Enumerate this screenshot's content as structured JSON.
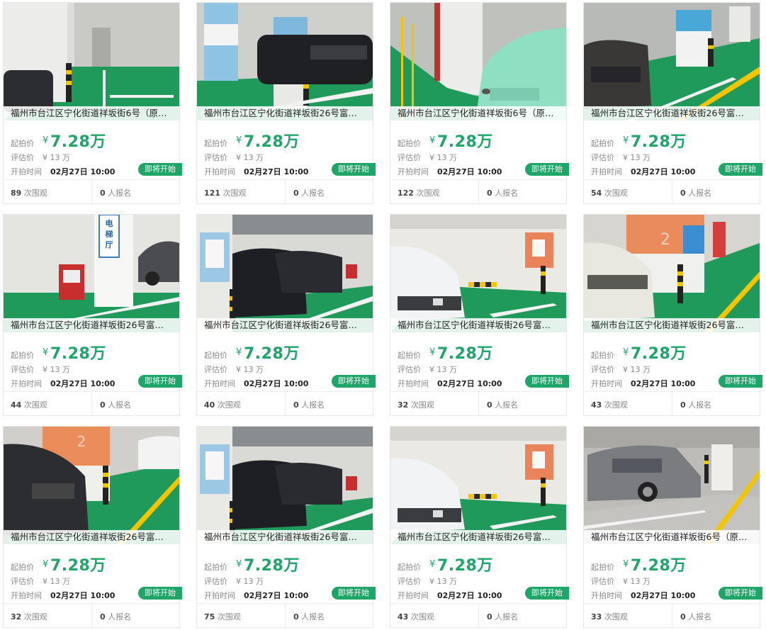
{
  "colors": {
    "accent": "#1ea668"
  },
  "labels": {
    "start_price": "起拍价",
    "estimate": "评估价",
    "start_time": "开拍时间",
    "yen": "¥",
    "views_suffix": "次围观",
    "signups_suffix": "人报名"
  },
  "listings": [
    {
      "title": "福州市台江区宁化街道祥坂街6号（原…",
      "price": "7.28万",
      "estimate": "¥ 13 万",
      "time": "02月27日 10:00",
      "status": "即将开始",
      "views": "89",
      "signups": "0",
      "photo": "garage-wall"
    },
    {
      "title": "福州市台江区宁化街道祥坂街26号富…",
      "price": "7.28万",
      "estimate": "¥ 13 万",
      "time": "02月27日 10:00",
      "status": "即将开始",
      "views": "121",
      "signups": "0",
      "photo": "blue-pillar-car"
    },
    {
      "title": "福州市台江区宁化街道祥坂街6号（原…",
      "price": "7.28万",
      "estimate": "¥ 13 万",
      "time": "02月27日 10:00",
      "status": "即将开始",
      "views": "122",
      "signups": "0",
      "photo": "green-car"
    },
    {
      "title": "福州市台江区宁化街道祥坂街26号富…",
      "price": "7.28万",
      "estimate": "¥ 13 万",
      "time": "02月27日 10:00",
      "status": "即将开始",
      "views": "54",
      "signups": "0",
      "photo": "dark-car-pillar"
    },
    {
      "title": "福州市台江区宁化街道祥坂街26号富…",
      "price": "7.28万",
      "estimate": "¥ 13 万",
      "time": "02月27日 10:00",
      "status": "即将开始",
      "views": "44",
      "signups": "0",
      "photo": "elevator-sign"
    },
    {
      "title": "福州市台江区宁化街道祥坂街26号富…",
      "price": "7.28万",
      "estimate": "¥ 13 万",
      "time": "02月27日 10:00",
      "status": "即将开始",
      "views": "40",
      "signups": "0",
      "photo": "blue-pillar-cars"
    },
    {
      "title": "福州市台江区宁化街道祥坂街26号富…",
      "price": "7.28万",
      "estimate": "¥ 13 万",
      "time": "02月27日 10:00",
      "status": "即将开始",
      "views": "32",
      "signups": "0",
      "photo": "white-suv"
    },
    {
      "title": "福州市台江区宁化街道祥坂街26号富…",
      "price": "7.28万",
      "estimate": "¥ 13 万",
      "time": "02月27日 10:00",
      "status": "即将开始",
      "views": "43",
      "signups": "0",
      "photo": "orange-pillar-suv"
    },
    {
      "title": "福州市台江区宁化街道祥坂街26号富…",
      "price": "7.28万",
      "estimate": "¥ 13 万",
      "time": "02月27日 10:00",
      "status": "即将开始",
      "views": "32",
      "signups": "0",
      "photo": "dark-suv-orange"
    },
    {
      "title": "福州市台江区宁化街道祥坂街26号富…",
      "price": "7.28万",
      "estimate": "¥ 13 万",
      "time": "02月27日 10:00",
      "status": "即将开始",
      "views": "75",
      "signups": "0",
      "photo": "blue-pillar-cars"
    },
    {
      "title": "福州市台江区宁化街道祥坂街26号富…",
      "price": "7.28万",
      "estimate": "¥ 13 万",
      "time": "02月27日 10:00",
      "status": "即将开始",
      "views": "43",
      "signups": "0",
      "photo": "white-suv"
    },
    {
      "title": "福州市台江区宁化街道祥坂街6号（原…",
      "price": "7.28万",
      "estimate": "¥ 13 万",
      "time": "02月27日 10:00",
      "status": "即将开始",
      "views": "33",
      "signups": "0",
      "photo": "grey-sedan"
    }
  ]
}
